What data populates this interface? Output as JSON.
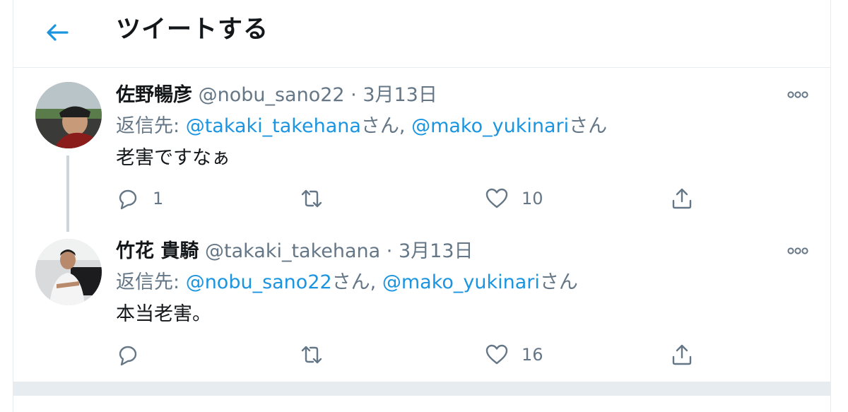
{
  "header": {
    "title": "ツイートする"
  },
  "tweets": [
    {
      "name": "佐野暢彦",
      "handle": "@nobu_sano22",
      "dot": " · ",
      "date": "3月13日",
      "reply_prefix": "返信先: ",
      "mention1": "@takaki_takehana",
      "suffix1": "さん, ",
      "mention2": "@mako_yukinari",
      "suffix2": "さん",
      "text": "老害ですなぁ",
      "reply_count": "1",
      "retweet_count": "",
      "like_count": "10"
    },
    {
      "name": "竹花 貴騎",
      "handle": "@takaki_takehana",
      "dot": " · ",
      "date": "3月13日",
      "reply_prefix": "返信先: ",
      "mention1": "@nobu_sano22",
      "suffix1": "さん, ",
      "mention2": "@mako_yukinari",
      "suffix2": "さん",
      "text": "本当老害。",
      "reply_count": "",
      "retweet_count": "",
      "like_count": "16"
    }
  ],
  "icons": {
    "back": "arrow-left-icon",
    "more": "more-icon",
    "reply": "reply-icon",
    "retweet": "retweet-icon",
    "like": "heart-icon",
    "share": "share-icon"
  },
  "colors": {
    "accent": "#1b95e0",
    "secondary_text": "#657786",
    "divider": "#e6ecf0"
  }
}
